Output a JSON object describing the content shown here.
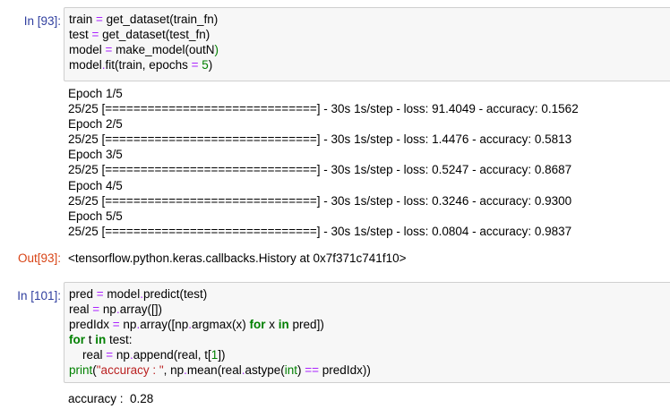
{
  "cells": [
    {
      "in_prompt": "In [93]:",
      "code": [
        [
          {
            "t": "train "
          },
          {
            "t": "=",
            "c": "op"
          },
          {
            "t": " get_dataset(train_fn)"
          }
        ],
        [
          {
            "t": "test "
          },
          {
            "t": "=",
            "c": "op"
          },
          {
            "t": " get_dataset(test_fn)"
          }
        ],
        [
          {
            "t": "model "
          },
          {
            "t": "=",
            "c": "op"
          },
          {
            "t": " make_model(outN"
          },
          {
            "t": ")",
            "c": "num"
          }
        ],
        [
          {
            "t": "model"
          },
          {
            "t": ".",
            "c": "op"
          },
          {
            "t": "fit(train, epochs "
          },
          {
            "t": "=",
            "c": "op"
          },
          {
            "t": " "
          },
          {
            "t": "5",
            "c": "num"
          },
          {
            "t": ")"
          }
        ]
      ],
      "stream_output": [
        "Epoch 1/5",
        "25/25 [==============================] - 30s 1s/step - loss: 91.4049 - accuracy: 0.1562",
        "Epoch 2/5",
        "25/25 [==============================] - 30s 1s/step - loss: 1.4476 - accuracy: 0.5813",
        "Epoch 3/5",
        "25/25 [==============================] - 30s 1s/step - loss: 0.5247 - accuracy: 0.8687",
        "Epoch 4/5",
        "25/25 [==============================] - 30s 1s/step - loss: 0.3246 - accuracy: 0.9300",
        "Epoch 5/5",
        "25/25 [==============================] - 30s 1s/step - loss: 0.0804 - accuracy: 0.9837"
      ],
      "out_prompt": "Out[93]:",
      "result": "<tensorflow.python.keras.callbacks.History at 0x7f371c741f10>"
    },
    {
      "in_prompt": "In [101]:",
      "code": [
        [
          {
            "t": "pred "
          },
          {
            "t": "=",
            "c": "op"
          },
          {
            "t": " model"
          },
          {
            "t": ".",
            "c": "op"
          },
          {
            "t": "predict(test)"
          }
        ],
        [
          {
            "t": "real "
          },
          {
            "t": "=",
            "c": "op"
          },
          {
            "t": " np"
          },
          {
            "t": ".",
            "c": "op"
          },
          {
            "t": "array([])"
          }
        ],
        [
          {
            "t": "predIdx "
          },
          {
            "t": "=",
            "c": "op"
          },
          {
            "t": " np"
          },
          {
            "t": ".",
            "c": "op"
          },
          {
            "t": "array([np"
          },
          {
            "t": ".",
            "c": "op"
          },
          {
            "t": "argmax(x) "
          },
          {
            "t": "for",
            "c": "kw"
          },
          {
            "t": " x "
          },
          {
            "t": "in",
            "c": "kw"
          },
          {
            "t": " pred])"
          }
        ],
        [
          {
            "t": "for",
            "c": "kw"
          },
          {
            "t": " t "
          },
          {
            "t": "in",
            "c": "kw"
          },
          {
            "t": " test:"
          }
        ],
        [
          {
            "t": "    real "
          },
          {
            "t": "=",
            "c": "op"
          },
          {
            "t": " np"
          },
          {
            "t": ".",
            "c": "op"
          },
          {
            "t": "append(real, t["
          },
          {
            "t": "1",
            "c": "num"
          },
          {
            "t": "])"
          }
        ],
        [
          {
            "t": "print",
            "c": "bi"
          },
          {
            "t": "(",
            "c": ""
          },
          {
            "t": "\"accuracy : \"",
            "c": "str"
          },
          {
            "t": ", np"
          },
          {
            "t": ".",
            "c": "op"
          },
          {
            "t": "mean(real"
          },
          {
            "t": ".",
            "c": "op"
          },
          {
            "t": "astype("
          },
          {
            "t": "int",
            "c": "bi"
          },
          {
            "t": ") "
          },
          {
            "t": "==",
            "c": "op"
          },
          {
            "t": " predIdx))"
          }
        ]
      ],
      "stream_output": [
        "accuracy :  0.28"
      ]
    }
  ]
}
